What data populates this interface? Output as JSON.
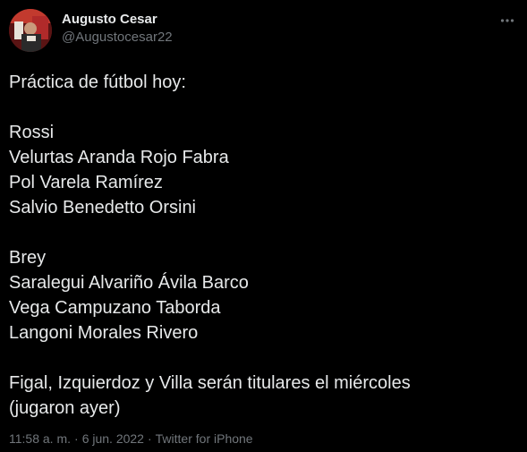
{
  "author": {
    "name": "Augusto Cesar",
    "handle": "@Augustocesar22"
  },
  "tweet": {
    "lines": [
      "Práctica de fútbol hoy:",
      "",
      "Rossi",
      "Velurtas Aranda Rojo Fabra",
      "Pol Varela Ramírez",
      "Salvio Benedetto Orsini",
      "",
      "Brey",
      "Saralegui Alvariño Ávila Barco",
      "Vega Campuzano Taborda",
      "Langoni Morales Rivero",
      "",
      "Figal, Izquierdoz y Villa serán titulares el miércoles",
      "(jugaron ayer)"
    ]
  },
  "meta": {
    "time": "11:58 a. m.",
    "separator": "·",
    "date": "6 jun. 2022",
    "source": "Twitter for iPhone"
  },
  "icons": {
    "more": "more-options-icon"
  },
  "colors": {
    "background": "#000000",
    "text_primary": "#e7e9ea",
    "text_secondary": "#71767b"
  }
}
